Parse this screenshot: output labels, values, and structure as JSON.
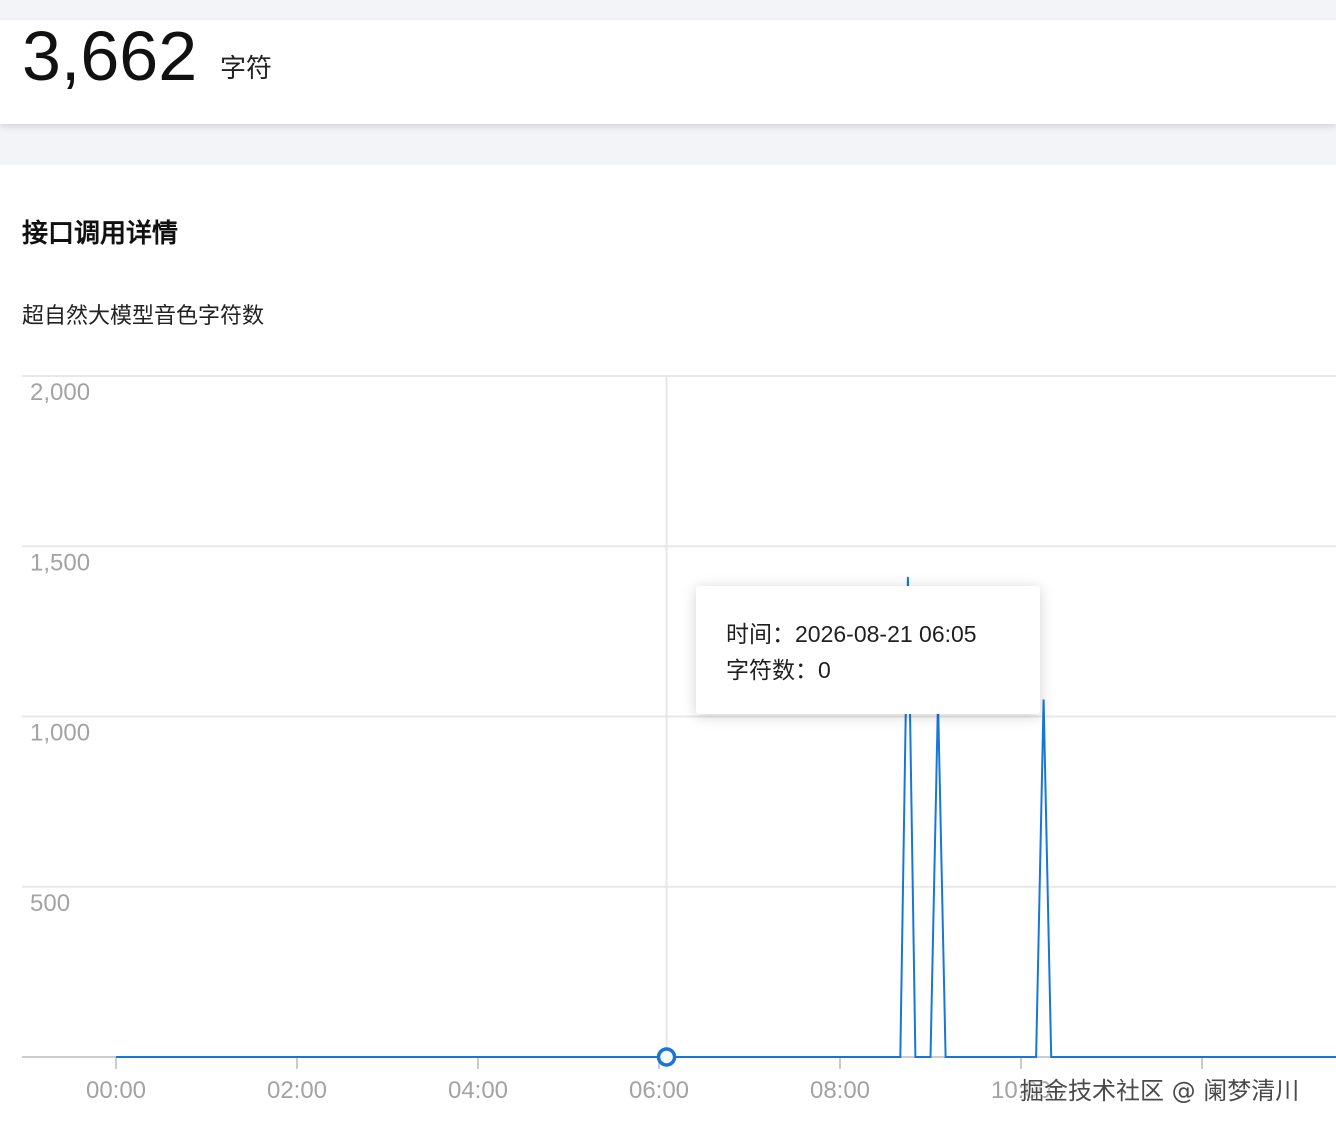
{
  "summary": {
    "value": "3,662",
    "unit": "字符"
  },
  "section": {
    "title": "接口调用详情"
  },
  "chart_data": {
    "type": "line",
    "title": "超自然大模型音色字符数",
    "xlabel": "",
    "ylabel": "",
    "ylim": [
      0,
      2000
    ],
    "xlim_hours": [
      -0.2,
      14.5
    ],
    "y_ticks": [
      {
        "value": 500,
        "label": "500"
      },
      {
        "value": 1000,
        "label": "1,000"
      },
      {
        "value": 1500,
        "label": "1,500"
      },
      {
        "value": 2000,
        "label": "2,000"
      }
    ],
    "x_ticks": [
      {
        "hour": 0,
        "label": "00:00"
      },
      {
        "hour": 2,
        "label": "02:00"
      },
      {
        "hour": 4,
        "label": "04:00"
      },
      {
        "hour": 6,
        "label": "06:00"
      },
      {
        "hour": 8,
        "label": "08:00"
      },
      {
        "hour": 10,
        "label": "10:00"
      },
      {
        "hour": 12,
        "label": ""
      }
    ],
    "series": [
      {
        "color": "#1677d9",
        "points": [
          {
            "time": "00:00",
            "value": 0
          },
          {
            "time": "08:40",
            "value": 0
          },
          {
            "time": "08:45",
            "value": 1410
          },
          {
            "time": "08:50",
            "value": 0
          },
          {
            "time": "09:00",
            "value": 0
          },
          {
            "time": "09:05",
            "value": 1050
          },
          {
            "time": "09:10",
            "value": 0
          },
          {
            "time": "10:10",
            "value": 0
          },
          {
            "time": "10:15",
            "value": 1050
          },
          {
            "time": "10:20",
            "value": 0
          },
          {
            "time": "14:30",
            "value": 0
          }
        ]
      }
    ],
    "highlight": {
      "time": "06:05",
      "value": 0
    }
  },
  "tooltip": {
    "time_label": "时间：",
    "time_value": "2026-08-21 06:05",
    "count_label": "字符数：",
    "count_value": "0"
  },
  "watermark": "掘金技术社区 @ 阑梦清川",
  "colors": {
    "line": "#1677d9",
    "grid": "#e8e8e8",
    "axis": "#cccccc"
  }
}
